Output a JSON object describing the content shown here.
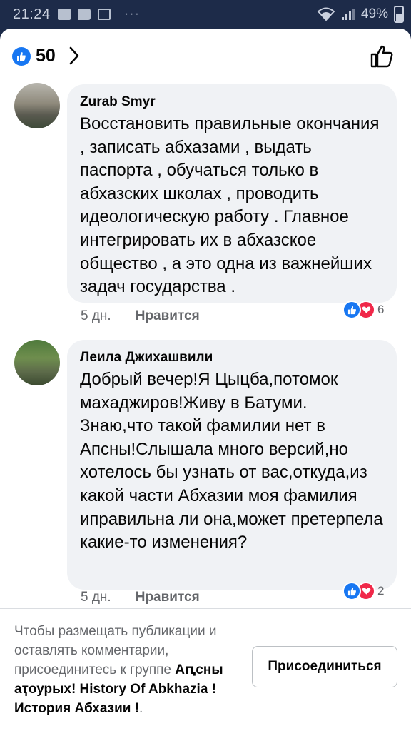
{
  "status_bar": {
    "time": "21:24",
    "dots": "···",
    "battery": "49%"
  },
  "header": {
    "like_count": "50",
    "icons": [
      "like-icon",
      "chevron-right-icon",
      "thumbs-up-outline-icon"
    ]
  },
  "comments": [
    {
      "author": "Zurab Smyr",
      "text": "Восстановить правильные окончания , записать абхазами , выдать паспорта , обучаться только в абхазских школах , проводить идеологическую работу . Главное интегрировать их в абхазское общество , а это одна из важнейших задач государства .",
      "time": "5 дн.",
      "like_label": "Нравится",
      "reaction_count": "6"
    },
    {
      "author": "Леила Джихашвили",
      "text": "Добрый вечер!Я Цыцба,потомок махаджиров!Живу в Батуми. Знаю,что такой фамилии нет в Апсны!Слышала много версий,но хотелось бы узнать от вас,откуда,из какой части Абхазии моя фамилия иправильна ли она,может претерпела какие-то изменения?",
      "time": "5 дн.",
      "like_label": "Нравится",
      "reaction_count": "2"
    }
  ],
  "join_bar": {
    "prompt": "Чтобы размещать публикации и оставлять комментарии, присоединитесь к группе",
    "group_name": "Аԥсны аҭоурых! History Of Abkhazia ! История Абхазии !",
    "suffix": ".",
    "button_label": "Присоединиться"
  },
  "colors": {
    "accent": "#1877f2",
    "love": "#f02849",
    "bubble": "#f0f2f5",
    "meta": "#65676b",
    "status_bar": "#1d2b49"
  }
}
